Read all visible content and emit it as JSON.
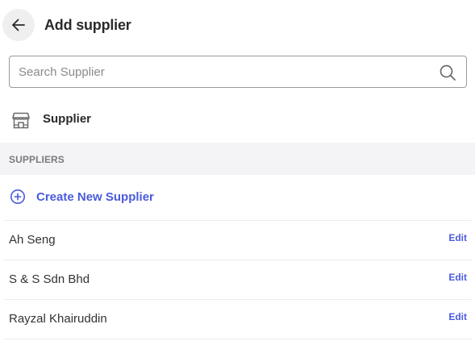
{
  "header": {
    "title": "Add supplier",
    "back_icon": "arrow-left-icon"
  },
  "search": {
    "placeholder": "Search Supplier",
    "value": "",
    "icon": "search-icon"
  },
  "category": {
    "label": "Supplier",
    "icon": "store-icon"
  },
  "section": {
    "label": "SUPPLIERS"
  },
  "create": {
    "label": "Create New Supplier",
    "icon": "plus-circle-icon",
    "color": "#4a5bdc"
  },
  "suppliers": [
    {
      "name": "Ah Seng",
      "edit_label": "Edit"
    },
    {
      "name": "S & S Sdn Bhd",
      "edit_label": "Edit"
    },
    {
      "name": "Rayzal Khairuddin",
      "edit_label": "Edit"
    }
  ]
}
